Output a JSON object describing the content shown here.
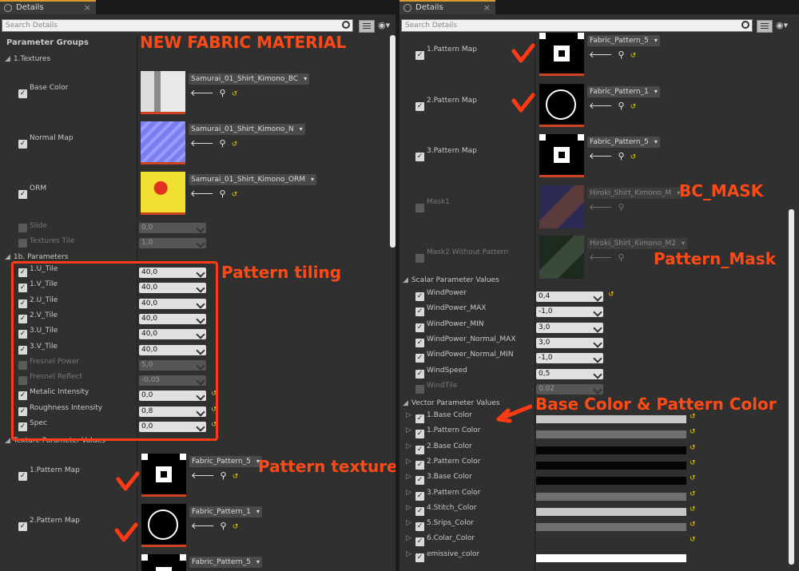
{
  "left": {
    "tab_title": "Details",
    "search_placeholder": "Search Details",
    "section_title": "Parameter Groups",
    "group_textures": "1.Textures",
    "textures": [
      {
        "label": "Base Color",
        "asset": "Samurai_01_Shirt_Kimono_BC"
      },
      {
        "label": "Normal Map",
        "asset": "Samurai_01_Shirt_Kimono_N"
      },
      {
        "label": "ORM",
        "asset": "Samurai_01_Shirt_Kimono_ORM"
      }
    ],
    "slide_label": "Slide",
    "slide_value": "0,0",
    "tile_label": "Textures Tile",
    "tile_value": "1,0",
    "group_params": "1b. Parameters",
    "params": [
      {
        "label": "1.U_Tile",
        "value": "40,0"
      },
      {
        "label": "1.V_Tile",
        "value": "40,0"
      },
      {
        "label": "2.U_Tile",
        "value": "40,0"
      },
      {
        "label": "2.V_Tile",
        "value": "40,0"
      },
      {
        "label": "3.U_Tile",
        "value": "40,0"
      },
      {
        "label": "3.V_Tile",
        "value": "40,0"
      },
      {
        "label": "Fresnel Power",
        "value": "5,0"
      },
      {
        "label": "Fresnel Reflect",
        "value": "-0,05"
      },
      {
        "label": "Metalic Intensity",
        "value": "0,0"
      },
      {
        "label": "Roughness Intensity",
        "value": "0,8"
      },
      {
        "label": "Spec",
        "value": "0,0"
      }
    ],
    "group_texture_params": "Texture Parameter Values",
    "patterns": [
      {
        "label": "1.Pattern Map",
        "asset": "Fabric_Pattern_5"
      },
      {
        "label": "2.Pattern Map",
        "asset": "Fabric_Pattern_1"
      },
      {
        "label": "",
        "asset": "Fabric_Pattern_5"
      }
    ]
  },
  "right": {
    "tab_title": "Details",
    "search_placeholder": "Search Details",
    "patterns": [
      {
        "label": "1.Pattern Map",
        "asset": "Fabric_Pattern_5"
      },
      {
        "label": "2.Pattern Map",
        "asset": "Fabric_Pattern_1"
      },
      {
        "label": "3.Pattern Map",
        "asset": "Fabric_Pattern_5"
      },
      {
        "label": "Mask1",
        "asset": "Hiroki_Shirt_Kimono_M"
      },
      {
        "label": "Mask2 Without Pattern",
        "asset": "Hiroki_Shirt_Kimono_M2"
      }
    ],
    "group_scalar": "Scalar Parameter Values",
    "scalars": [
      {
        "label": "WindPower",
        "value": "0,4"
      },
      {
        "label": "WindPower_MAX",
        "value": "-1,0"
      },
      {
        "label": "WindPower_MIN",
        "value": "3,0"
      },
      {
        "label": "WindPower_Normal_MAX",
        "value": "3,0"
      },
      {
        "label": "WindPower_Normal_MIN",
        "value": "-1,0"
      },
      {
        "label": "WindSpeed",
        "value": "0,5"
      },
      {
        "label": "WindTile",
        "value": "0,02"
      }
    ],
    "group_vector": "Vector Parameter Values",
    "vectors": [
      {
        "label": "1.Base Color",
        "color": "#c8c8c8"
      },
      {
        "label": "1.Pattern Color",
        "color": "#707070"
      },
      {
        "label": "2.Base Color",
        "color": "#050505"
      },
      {
        "label": "2.Pattern Color",
        "color": "#050505"
      },
      {
        "label": "3.Base Color",
        "color": "#050505"
      },
      {
        "label": "3.Pattern Color",
        "color": "#707070"
      },
      {
        "label": "4.Stitch_Color",
        "color": "#c8c8c8"
      },
      {
        "label": "5.Srips_Color",
        "color": "#707070"
      },
      {
        "label": "6.Colar_Color",
        "color": "#303030"
      },
      {
        "label": "emissive_color",
        "color": "#ffffff"
      }
    ]
  },
  "annotations": {
    "new_fabric": "NEW FABRIC MATERIAL",
    "pattern_tiling": "Pattern tiling",
    "pattern_texture": "Pattern texture",
    "bc_mask": "BC_MASK",
    "pattern_mask": "Pattern_Mask",
    "base_pattern_color": "Base Color & Pattern Color"
  },
  "colors": {
    "annotation": "#ff4a16",
    "accent_tab": "#e09a2a"
  }
}
